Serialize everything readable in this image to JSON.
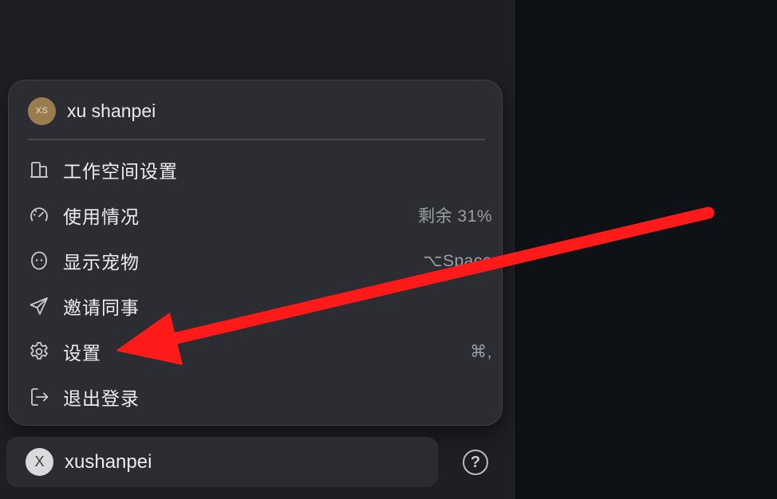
{
  "menu": {
    "user": {
      "avatar_initials": "XS",
      "name": "xu shanpei",
      "avatar_color": "#9b7c4e"
    },
    "items": [
      {
        "icon": "building-icon",
        "label": "工作空间设置",
        "right": ""
      },
      {
        "icon": "gauge-icon",
        "label": "使用情况",
        "right": "剩余 31%"
      },
      {
        "icon": "pet-icon",
        "label": "显示宠物",
        "right": "⌥Space"
      },
      {
        "icon": "send-icon",
        "label": "邀请同事",
        "right": ""
      },
      {
        "icon": "gear-icon",
        "label": "设置",
        "right": "⌘,"
      },
      {
        "icon": "logout-icon",
        "label": "退出登录",
        "right": ""
      }
    ]
  },
  "bottom_bar": {
    "avatar_initial": "X",
    "username": "xushanpei"
  },
  "help": {
    "icon": "help-icon",
    "glyph": "?"
  },
  "annotation": {
    "type": "arrow",
    "color": "#ff1a1a",
    "target": "设置"
  }
}
